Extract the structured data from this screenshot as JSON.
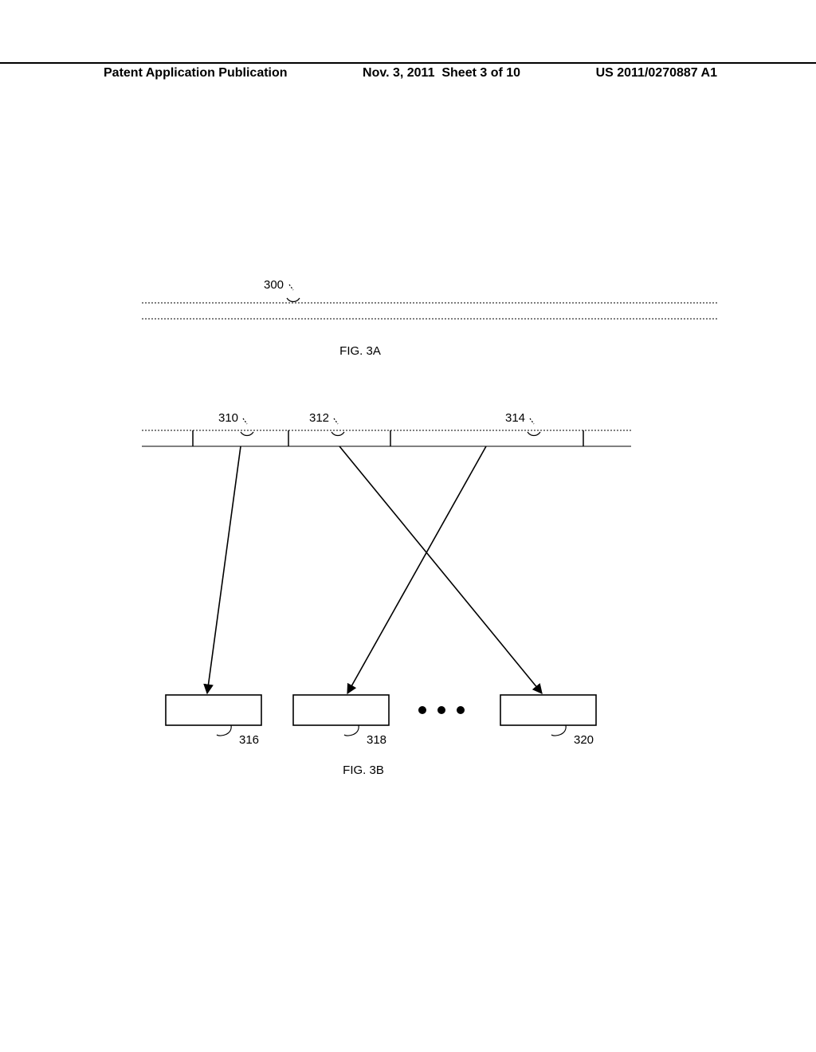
{
  "header": {
    "left": "Patent Application Publication",
    "center": "Nov. 3, 2011  Sheet 3 of 10",
    "right": "US 2011/0270887 A1"
  },
  "figA": {
    "label": "FIG. 3A",
    "ref300": "300"
  },
  "figB": {
    "label": "FIG. 3B",
    "ref310": "310",
    "ref312": "312",
    "ref314": "314",
    "ref316": "316",
    "ref318": "318",
    "ref320": "320"
  }
}
